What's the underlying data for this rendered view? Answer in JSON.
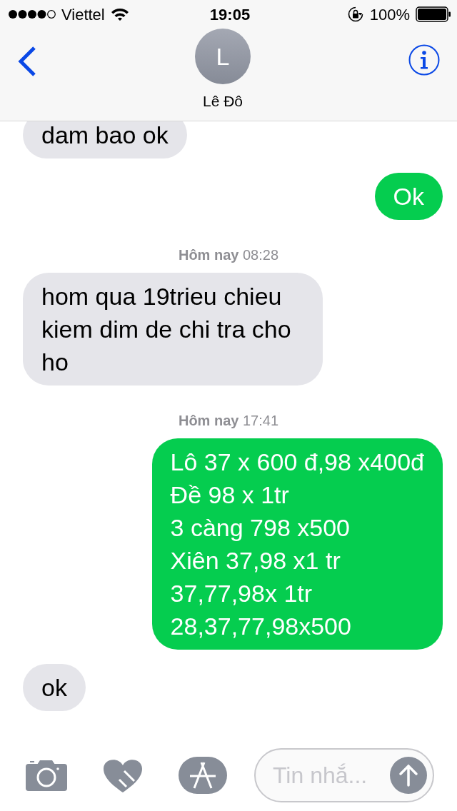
{
  "status_bar": {
    "carrier": "Viettel",
    "time": "19:05",
    "battery": "100%"
  },
  "header": {
    "avatar_initial": "L",
    "contact": "Lê Đô"
  },
  "messages": [
    {
      "kind": "received",
      "text": "dam bao ok"
    },
    {
      "kind": "sent",
      "text": "Ok"
    },
    {
      "kind": "timestamp",
      "text": "**Hôm nay** 08:28"
    },
    {
      "kind": "received",
      "text": "hom qua 19trieu chieu kiem dim de chi tra cho ho"
    },
    {
      "kind": "timestamp",
      "text": "**Hôm nay** 17:41"
    },
    {
      "kind": "sent",
      "text": "Lô 37 x 600 đ,98 x400đ\nĐề 98 x 1tr\n3 càng 798 x500\nXiên 37,98 x1 tr\n37,77,98x 1tr\n28,37,77,98x500"
    },
    {
      "kind": "received",
      "text": "ok"
    }
  ],
  "composer": {
    "placeholder": "Tin nhắ..."
  }
}
